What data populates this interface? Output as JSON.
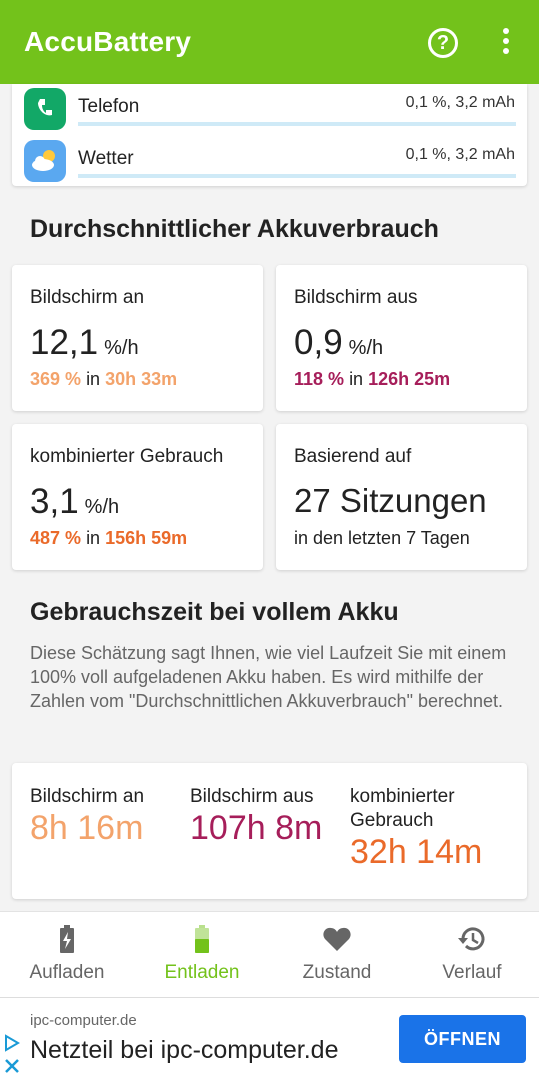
{
  "appbar": {
    "title": "AccuBattery",
    "help_icon": "help-circle-icon",
    "more_icon": "more-vert-icon"
  },
  "apps": [
    {
      "name": "Telefon",
      "value": "0,1 %, 3,2 mAh",
      "icon": "phone-icon",
      "icon_color": "#12a867",
      "usage_fraction": 0.0
    },
    {
      "name": "Wetter",
      "value": "0,1 %, 3,2 mAh",
      "icon": "weather-icon",
      "icon_color": "#5aa8f0",
      "usage_fraction": 0.0
    }
  ],
  "avg": {
    "title": "Durchschnittlicher Akkuverbrauch",
    "screen_on": {
      "label": "Bildschirm an",
      "value": "12,1",
      "unit": "%/h",
      "pct": "369 %",
      "in": "in",
      "time": "30h 33m"
    },
    "screen_off": {
      "label": "Bildschirm aus",
      "value": "0,9",
      "unit": "%/h",
      "pct": "118 %",
      "in": "in",
      "time": "126h 25m"
    },
    "combined": {
      "label": "kombinierter Gebrauch",
      "value": "3,1",
      "unit": "%/h",
      "pct": "487 %",
      "in": "in",
      "time": "156h 59m"
    },
    "based": {
      "label": "Basierend auf",
      "value": "27 Sitzungen",
      "sub": "in den letzten 7 Tagen"
    }
  },
  "full": {
    "title": "Gebrauchszeit bei vollem Akku",
    "description": "Diese Schätzung sagt Ihnen, wie viel Laufzeit Sie mit einem 100% voll aufgeladenen Akku haben. Es wird mithilfe der Zahlen vom \"Durchschnittlichen Akkuverbrauch\" berechnet.",
    "screen_on": {
      "label": "Bildschirm an",
      "value": "8h 16m"
    },
    "screen_off": {
      "label": "Bildschirm aus",
      "value": "107h 8m"
    },
    "combined": {
      "label": "kombinierter Gebrauch",
      "value": "32h 14m"
    }
  },
  "nav": {
    "items": [
      {
        "label": "Aufladen",
        "icon": "battery-charging-icon",
        "active": false
      },
      {
        "label": "Entladen",
        "icon": "battery-discharging-icon",
        "active": true
      },
      {
        "label": "Zustand",
        "icon": "heart-icon",
        "active": false
      },
      {
        "label": "Verlauf",
        "icon": "history-icon",
        "active": false
      }
    ],
    "active_color": "#73c21b",
    "inactive_color": "#666666"
  },
  "ad": {
    "domain": "ipc-computer.de",
    "headline": "Netzteil bei ipc-computer.de",
    "cta": "ÖFFNEN",
    "adchoices_icon": "adchoices-icon"
  },
  "colors": {
    "primary": "#73c21b",
    "screen_on": "#f3a36b",
    "screen_off": "#a61e5a",
    "combined": "#ea6a2a",
    "cta": "#1a73e8"
  }
}
